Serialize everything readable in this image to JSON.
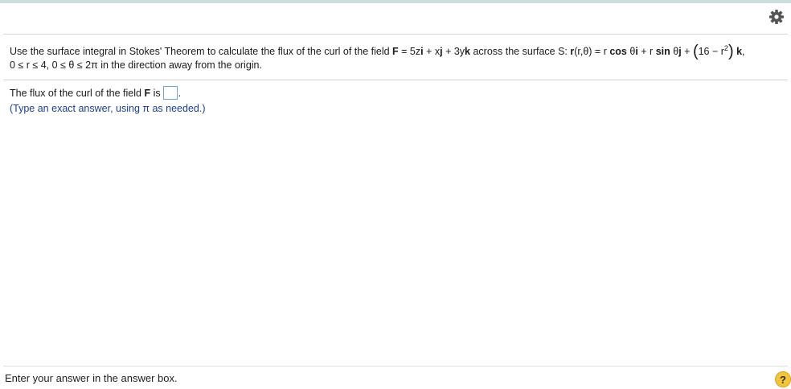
{
  "header": {
    "settings_icon": "gear-icon"
  },
  "question": {
    "intro": "Use the surface integral in Stokes' Theorem to calculate the flux of the curl of the field ",
    "field_label": "F",
    "field_eq": " = 5z",
    "i1": "i",
    "plus_x": " + x",
    "j1": "j",
    "plus_3y": " + 3y",
    "k1": "k",
    "across": " across the surface S: ",
    "r_label": "r",
    "r_args": "(r,θ) = r ",
    "cos": "cos",
    "theta_i": " θ",
    "i2": "i",
    "plus_r": " + r ",
    "sin": "sin",
    "theta_j": " θ",
    "j2": "j",
    "plus": " + ",
    "paren_open": "(",
    "poly": "16 − r",
    "exponent": "2",
    "paren_close": ")",
    "k2": "k",
    "comma": ",",
    "bounds": "0 ≤ r ≤ 4, 0 ≤ θ ≤ 2π in the direction away from the origin."
  },
  "answer": {
    "prefix": "The flux of the curl of the field ",
    "field": "F",
    "verb": " is",
    "period": ".",
    "hint": "(Type an exact answer, using π as needed.)"
  },
  "footer": {
    "message": "Enter your answer in the answer box.",
    "help_label": "?"
  }
}
